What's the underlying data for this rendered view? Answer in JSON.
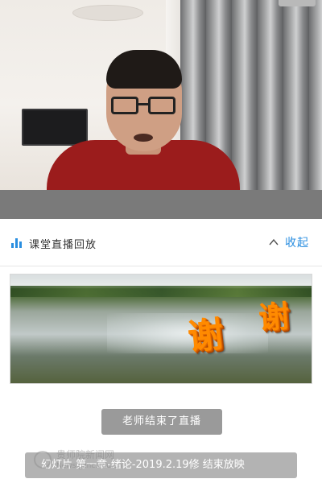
{
  "video": {
    "description_free": true
  },
  "section": {
    "title": "课堂直播回放",
    "collapse_label": "收起",
    "icon": "bar-chart-icon",
    "accent": "#2a8ee0"
  },
  "slide": {
    "chars": [
      "谢",
      "谢"
    ]
  },
  "status": {
    "label": "老师结束了直播"
  },
  "marquee": {
    "text": "幻灯片 第一章-绪论-2019.2.19修 结束放映"
  },
  "watermark": {
    "name": "贵师院新闻网",
    "url": "News.gznc.edu.cn"
  },
  "colors": {
    "band": "#7a7a7a",
    "status_bg": "#9a9a9a",
    "marquee_bg": "#b3b3b3"
  }
}
